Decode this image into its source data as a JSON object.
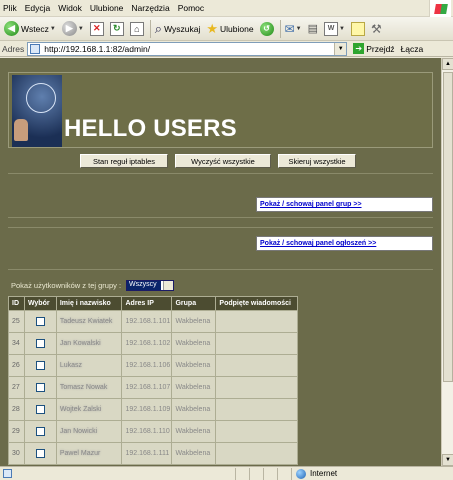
{
  "menu": [
    "Plik",
    "Edycja",
    "Widok",
    "Ulubione",
    "Narzędzia",
    "Pomoc"
  ],
  "toolbar": {
    "back_label": "Wstecz",
    "search_label": "Wyszukaj",
    "favorites_label": "Ulubione"
  },
  "address": {
    "label": "Adres",
    "url": "http://192.168.1.1:82/admin/",
    "go_label": "Przejdź",
    "links_label": "Łącza"
  },
  "page": {
    "title": "HELLO USERS",
    "buttons": [
      "Stan reguł iptables",
      "Wyczyść wszystkie",
      "Skieruj wszystkie"
    ],
    "group_panel_link": "Pokaż / schowaj panel grup >>",
    "notice_panel_link": "Pokaż / schowaj panel ogłoszeń >>",
    "group_filter_label": "Pokaż użytkowników z tej grupy :",
    "group_filter_value": "Wszyscy",
    "table": {
      "headers": [
        "ID",
        "Wybór",
        "Imię i nazwisko",
        "Adres IP",
        "Grupa",
        "Podpięte wiadomości"
      ],
      "rows": [
        {
          "id": "25",
          "name": "Tadeusz Kwiatek",
          "ip": "192.168.1.101",
          "group": "Wakbelena",
          "msg": ""
        },
        {
          "id": "34",
          "name": "Jan Kowalski",
          "ip": "192.168.1.102",
          "group": "Wakbelena",
          "msg": ""
        },
        {
          "id": "26",
          "name": "Lukasz",
          "ip": "192.168.1.106",
          "group": "Wakbelena",
          "msg": ""
        },
        {
          "id": "27",
          "name": "Tomasz Nowak",
          "ip": "192.168.1.107",
          "group": "Wakbelena",
          "msg": ""
        },
        {
          "id": "28",
          "name": "Wojtek Zalski",
          "ip": "192.168.1.109",
          "group": "Wakbelena",
          "msg": ""
        },
        {
          "id": "29",
          "name": "Jan Nowicki",
          "ip": "192.168.1.110",
          "group": "Wakbelena",
          "msg": ""
        },
        {
          "id": "30",
          "name": "Pawel Mazur",
          "ip": "192.168.1.111",
          "group": "Wakbelena",
          "msg": ""
        }
      ]
    }
  },
  "status": {
    "zone": "Internet"
  },
  "colors": {
    "page_bg": "#6b6b4a",
    "banner_bg": "#6e6e48",
    "table_header": "#4c4c31",
    "table_cell": "#d9d8c4",
    "link": "#0000cc"
  }
}
